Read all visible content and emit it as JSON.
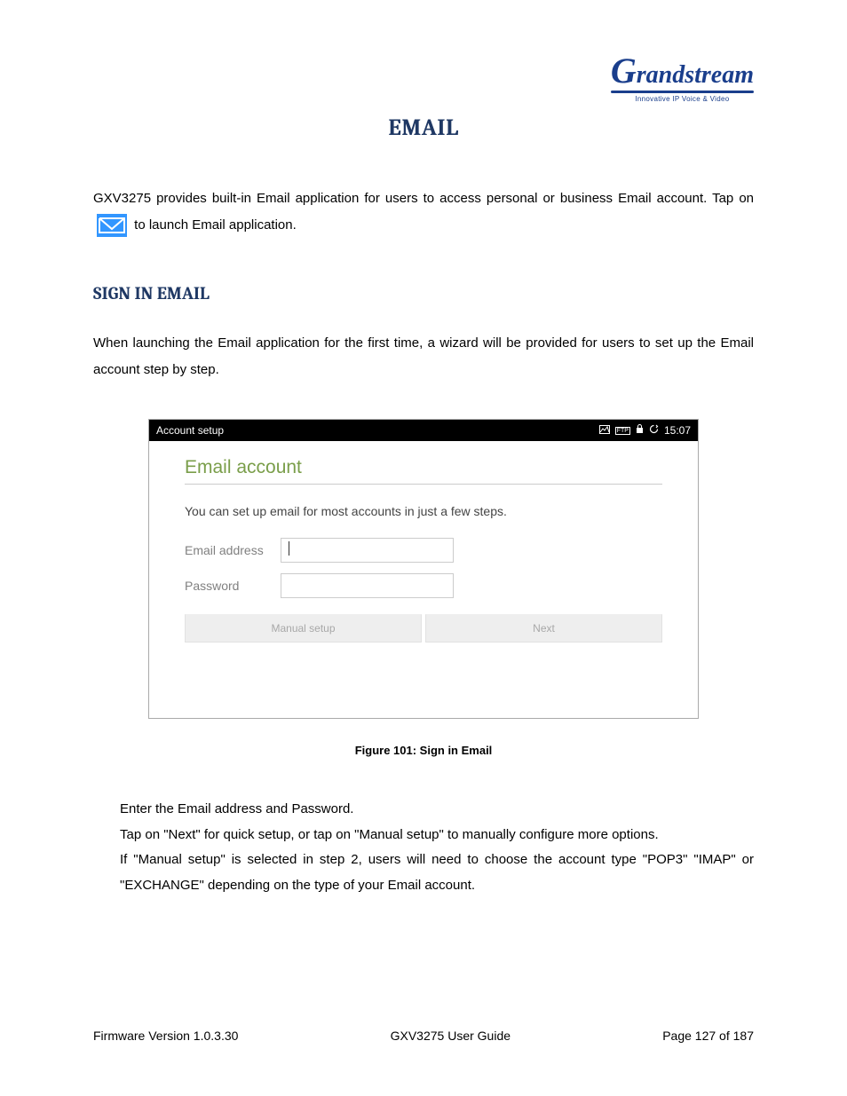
{
  "logo": {
    "name": "Grandstream",
    "tagline": "Innovative IP Voice & Video"
  },
  "title": "EMAIL",
  "intro_part1": "GXV3275 provides built-in Email application for users to access personal or business Email account. Tap on",
  "intro_part2": "to launch Email application.",
  "section_heading": "SIGN IN EMAIL",
  "section_body": "When launching the Email application for the first time, a wizard will be provided for users to set up the Email account step by step.",
  "screenshot": {
    "bar_title": "Account setup",
    "bar_time": "15:07",
    "heading": "Email account",
    "desc": "You can set up email for most accounts in just a few steps.",
    "label_email": "Email address",
    "label_password": "Password",
    "btn_manual": "Manual setup",
    "btn_next": "Next"
  },
  "figure_caption": "Figure 101: Sign in Email",
  "bullets": {
    "b1": "Enter the Email address and Password.",
    "b2": "Tap on \"Next\" for quick setup, or tap on \"Manual setup\" to manually configure more options.",
    "b3": "If \"Manual setup\" is selected in step 2, users will need to choose the account type \"POP3\" \"IMAP\" or \"EXCHANGE\" depending on the type of your Email account."
  },
  "footer": {
    "left": "Firmware Version 1.0.3.30",
    "center": "GXV3275 User Guide",
    "right": "Page 127 of 187"
  }
}
